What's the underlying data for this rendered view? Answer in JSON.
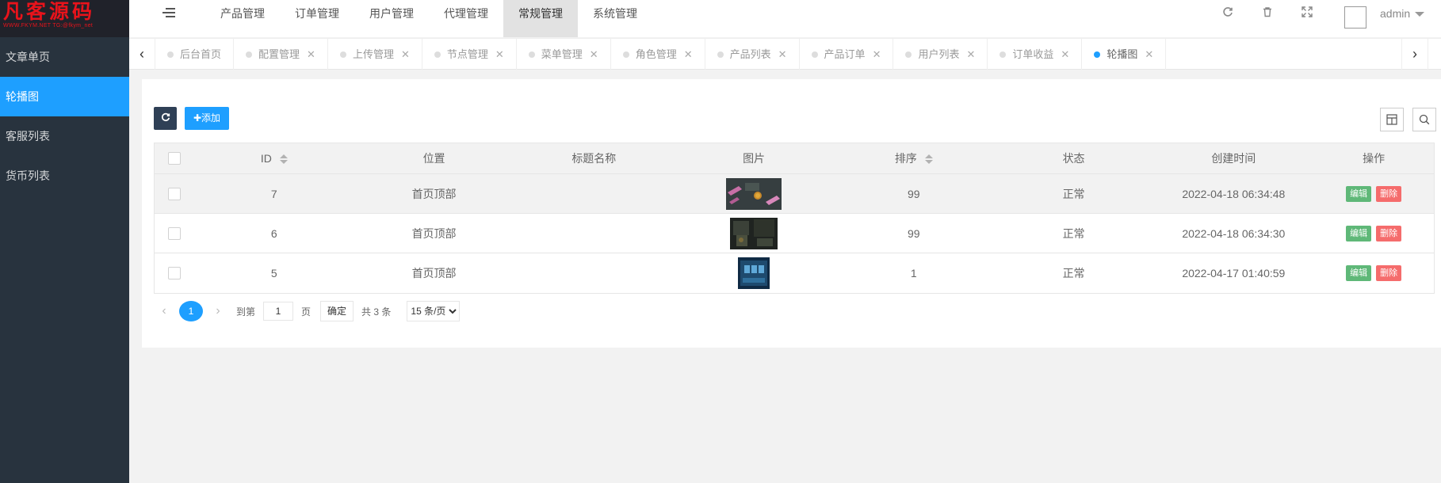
{
  "brand": {
    "name": "凡客源码",
    "sub": "WWW.FKYM.NET  TG:@fkym_net",
    "color": "#e8131b"
  },
  "sidebar": {
    "items": [
      {
        "label": "文章单页",
        "active": false
      },
      {
        "label": "轮播图",
        "active": true
      },
      {
        "label": "客服列表",
        "active": false
      },
      {
        "label": "货币列表",
        "active": false
      }
    ]
  },
  "header": {
    "nav": [
      {
        "label": "产品管理"
      },
      {
        "label": "订单管理"
      },
      {
        "label": "用户管理"
      },
      {
        "label": "代理管理"
      },
      {
        "label": "常规管理",
        "active": true
      },
      {
        "label": "系统管理"
      }
    ],
    "icons": [
      "refresh-icon",
      "trash-icon",
      "fullscreen-icon"
    ],
    "user": "admin"
  },
  "tabs": [
    {
      "label": "后台首页",
      "closable": false
    },
    {
      "label": "配置管理",
      "closable": true
    },
    {
      "label": "上传管理",
      "closable": true
    },
    {
      "label": "节点管理",
      "closable": true
    },
    {
      "label": "菜单管理",
      "closable": true
    },
    {
      "label": "角色管理",
      "closable": true
    },
    {
      "label": "产品列表",
      "closable": true
    },
    {
      "label": "产品订单",
      "closable": true
    },
    {
      "label": "用户列表",
      "closable": true
    },
    {
      "label": "订单收益",
      "closable": true
    },
    {
      "label": "轮播图",
      "closable": true,
      "active": true
    }
  ],
  "toolbar": {
    "add_label": "添加"
  },
  "table": {
    "columns": [
      "ID",
      "位置",
      "标题名称",
      "图片",
      "排序",
      "状态",
      "创建时间",
      "操作"
    ],
    "rows": [
      {
        "id": "7",
        "position": "首页顶部",
        "title": "",
        "sort": "99",
        "status": "正常",
        "created": "2022-04-18 06:34:48"
      },
      {
        "id": "6",
        "position": "首页顶部",
        "title": "",
        "sort": "99",
        "status": "正常",
        "created": "2022-04-18 06:34:30"
      },
      {
        "id": "5",
        "position": "首页顶部",
        "title": "",
        "sort": "1",
        "status": "正常",
        "created": "2022-04-17 01:40:59"
      }
    ],
    "edit_label": "编辑",
    "delete_label": "删除"
  },
  "pagination": {
    "current": "1",
    "goto_label": "到第",
    "page_value": "1",
    "page_unit": "页",
    "confirm_label": "确定",
    "total_text": "共 3 条",
    "page_size": "15 条/页"
  },
  "colors": {
    "primary": "#1e9fff",
    "sidebar": "#28333e",
    "edit": "#5fb878",
    "delete": "#f56c6c"
  }
}
